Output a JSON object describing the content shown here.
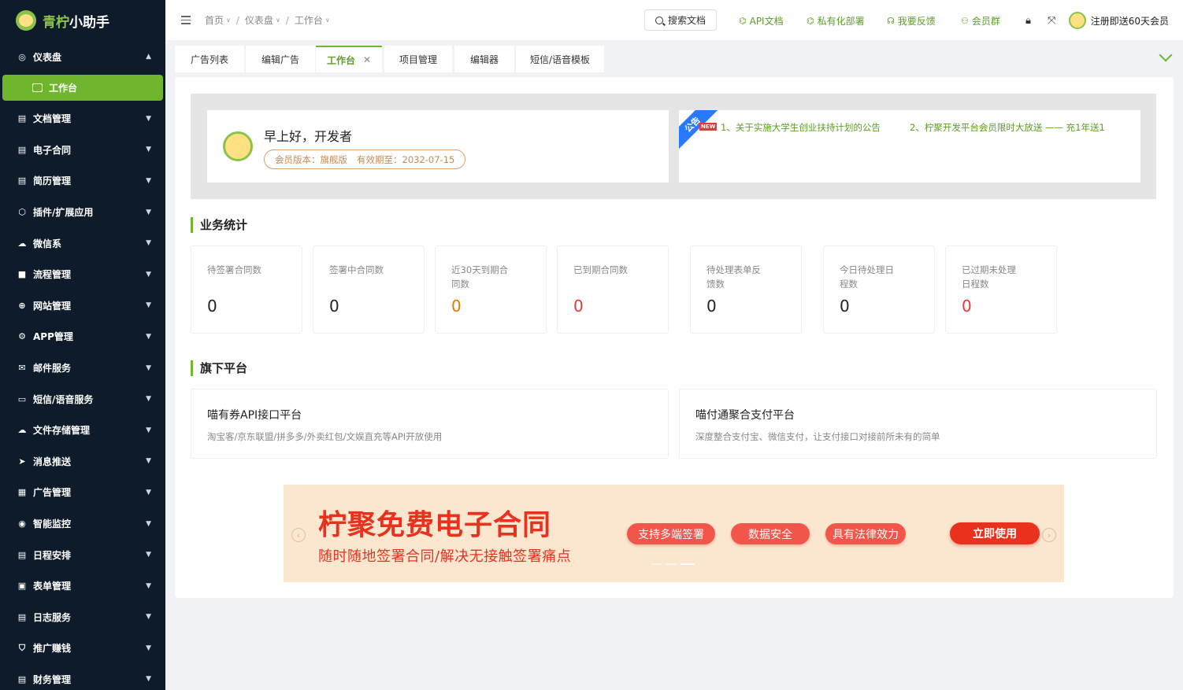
{
  "brand": {
    "name_part1": "青柠",
    "name_part2": "小助手"
  },
  "sidebar": {
    "dashboard": {
      "label": "仪表盘"
    },
    "active_sub": {
      "label": "工作台"
    },
    "items": [
      {
        "label": "文档管理",
        "icon": "doc-icon"
      },
      {
        "label": "电子合同",
        "icon": "contract-icon"
      },
      {
        "label": "简历管理",
        "icon": "resume-icon"
      },
      {
        "label": "插件/扩展应用",
        "icon": "plugin-icon"
      },
      {
        "label": "微信系",
        "icon": "wechat-icon"
      },
      {
        "label": "流程管理",
        "icon": "flow-icon"
      },
      {
        "label": "网站管理",
        "icon": "globe-icon"
      },
      {
        "label": "APP管理",
        "icon": "app-icon"
      },
      {
        "label": "邮件服务",
        "icon": "mail-icon"
      },
      {
        "label": "短信/语音服务",
        "icon": "sms-icon"
      },
      {
        "label": "文件存储管理",
        "icon": "storage-icon"
      },
      {
        "label": "消息推送",
        "icon": "send-icon"
      },
      {
        "label": "广告管理",
        "icon": "ad-icon"
      },
      {
        "label": "智能监控",
        "icon": "monitor-icon"
      },
      {
        "label": "日程安排",
        "icon": "schedule-icon"
      },
      {
        "label": "表单管理",
        "icon": "form-icon"
      },
      {
        "label": "日志服务",
        "icon": "log-icon"
      },
      {
        "label": "推广赚钱",
        "icon": "promote-icon"
      },
      {
        "label": "财务管理",
        "icon": "finance-icon"
      }
    ]
  },
  "header": {
    "breadcrumbs": [
      "首页",
      "仪表盘",
      "工作台"
    ],
    "search_label": "搜索文档",
    "links": [
      "API文档",
      "私有化部署",
      "我要反馈",
      "会员群"
    ],
    "user_text": "注册即送60天会员"
  },
  "tabs": [
    "广告列表",
    "编辑广告",
    "工作台",
    "项目管理",
    "编辑器",
    "短信/语音模板"
  ],
  "welcome": {
    "greeting": "早上好，开发者",
    "member_version": "会员版本：旗舰版",
    "expire": "有效期至：2032-07-15"
  },
  "notice": {
    "ribbon": "公告",
    "new_tag": "NEW",
    "items": [
      "1、关于实施大学生创业扶持计划的公告",
      "2、柠聚开发平台会员限时大放送 —— 充1年送1"
    ]
  },
  "stats_section": {
    "title": "业务统计"
  },
  "stats": [
    {
      "label": "待签署合同数",
      "value": "0",
      "tone": "normal"
    },
    {
      "label": "签署中合同数",
      "value": "0",
      "tone": "normal"
    },
    {
      "label": "近30天到期合同数",
      "value": "0",
      "tone": "orange"
    },
    {
      "label": "已到期合同数",
      "value": "0",
      "tone": "red"
    },
    {
      "label": "待处理表单反馈数",
      "value": "0",
      "tone": "normal"
    },
    {
      "label": "今日待处理日程数",
      "value": "0",
      "tone": "normal"
    },
    {
      "label": "已过期未处理日程数",
      "value": "0",
      "tone": "red"
    }
  ],
  "platform_section": {
    "title": "旗下平台"
  },
  "platforms": [
    {
      "title": "喵有券API接口平台",
      "desc": "淘宝客/京东联盟/拼多多/外卖红包/文娱直充等API开放使用"
    },
    {
      "title": "喵付通聚合支付平台",
      "desc": "深度整合支付宝、微信支付，让支付接口对接前所未有的简单"
    }
  ],
  "banner": {
    "title": "柠聚免费电子合同",
    "subtitle": "随时随地签署合同/解决无接触签署痛点",
    "pills": [
      "支持多端签署",
      "数据安全",
      "具有法律效力"
    ],
    "cta": "立即使用"
  },
  "colors": {
    "accent": "#6fb52e",
    "sidebar_bg": "#0e1b2b",
    "danger": "#e53935",
    "warning": "#e07b00"
  }
}
